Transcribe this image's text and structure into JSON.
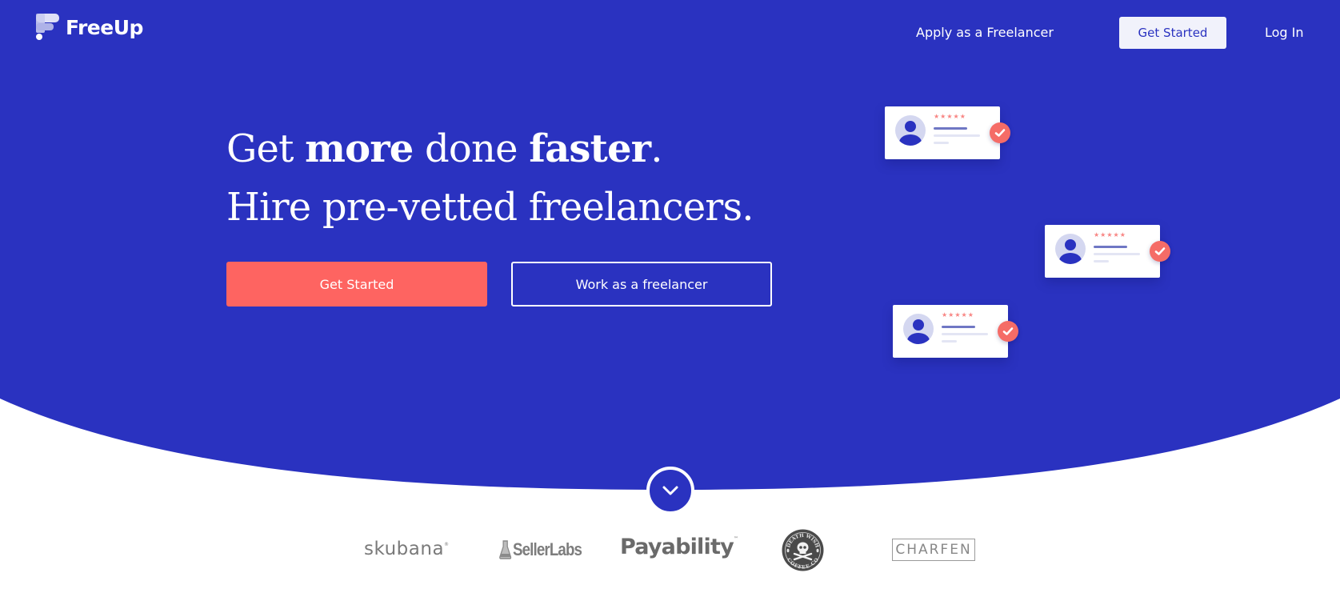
{
  "brand": {
    "name": "FreeUp",
    "primary_color": "#2a32c0",
    "accent_color": "#fe6461",
    "logo_icon": "freeup-f-mark-icon"
  },
  "nav": {
    "apply_label": "Apply as a Freelancer",
    "cta_label": "Get Started",
    "login_label": "Log In"
  },
  "hero": {
    "headline_line1": [
      {
        "text": "Get ",
        "weight": "light"
      },
      {
        "text": "more",
        "weight": "bold"
      },
      {
        "text": " done ",
        "weight": "light"
      },
      {
        "text": "faster",
        "weight": "bold"
      },
      {
        "text": ".",
        "weight": "light"
      }
    ],
    "headline_line2": "Hire pre-vetted freelancers.",
    "primary_button": "Get Started",
    "secondary_button": "Work as a freelancer"
  },
  "review_cards": [
    {
      "rating": 5,
      "stars": "★★★★★",
      "verified_icon": "check-icon"
    },
    {
      "rating": 5,
      "stars": "★★★★★",
      "verified_icon": "check-icon"
    },
    {
      "rating": 5,
      "stars": "★★★★★",
      "verified_icon": "check-icon"
    }
  ],
  "scroll_down_icon": "chevron-down-icon",
  "clients": {
    "skubana": "skubana",
    "sellerlabs": "SellerLabs",
    "payability": "Payability",
    "deathwish_top": "DEATH WISH",
    "deathwish_bottom": "COFFEE CO",
    "charfen": "CHARFEN"
  }
}
